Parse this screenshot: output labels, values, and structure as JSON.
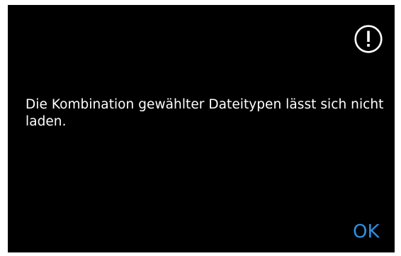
{
  "dialog": {
    "icon": "exclamation-circle-icon",
    "message": "Die Kombination gewählter Dateitypen lässt sich nicht laden.",
    "ok_label": "OK"
  },
  "colors": {
    "background": "#000000",
    "text": "#ffffff",
    "accent": "#2f8fe0"
  }
}
